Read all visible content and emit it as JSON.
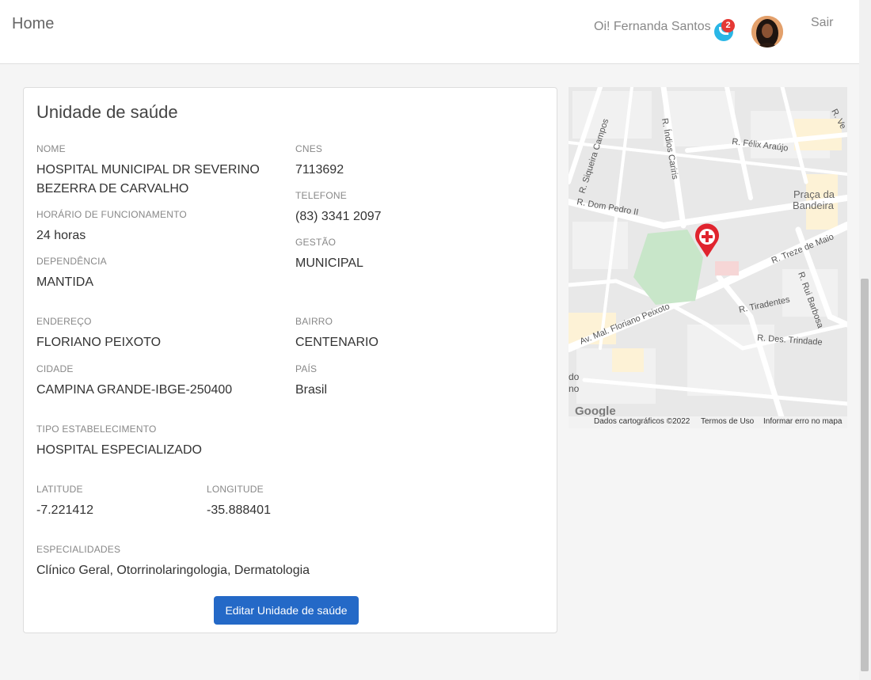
{
  "header": {
    "home": "Home",
    "greeting": "Oi! Fernanda Santos",
    "notification_count": "2",
    "logout": "Sair"
  },
  "card": {
    "title": "Unidade de saúde",
    "fields": {
      "nome": {
        "label": "NOME",
        "value": "HOSPITAL MUNICIPAL DR SEVERINO BEZERRA DE CARVALHO"
      },
      "cnes": {
        "label": "CNES",
        "value": "7113692"
      },
      "telefone": {
        "label": "TELEFONE",
        "value": "(83) 3341 2097"
      },
      "horario": {
        "label": "HORÁRIO DE FUNCIONAMENTO",
        "value": "24 horas"
      },
      "gestao": {
        "label": "GESTÃO",
        "value": "MUNICIPAL"
      },
      "dependencia": {
        "label": "DEPENDÊNCIA",
        "value": "MANTIDA"
      },
      "endereco": {
        "label": "ENDEREÇO",
        "value": "FLORIANO PEIXOTO"
      },
      "bairro": {
        "label": "BAIRRO",
        "value": "CENTENARIO"
      },
      "cidade": {
        "label": "CIDADE",
        "value": "CAMPINA GRANDE-IBGE-250400"
      },
      "pais": {
        "label": "PAÍS",
        "value": "Brasil"
      },
      "tipo": {
        "label": "TIPO ESTABELECIMENTO",
        "value": "HOSPITAL ESPECIALIZADO"
      },
      "latitude": {
        "label": "LATITUDE",
        "value": "-7.221412"
      },
      "longitude": {
        "label": "LONGITUDE",
        "value": "-35.888401"
      },
      "especialidades": {
        "label": "ESPECIALIDADES",
        "value": "Clínico Geral, Otorrinolaringologia, Dermatologia"
      }
    },
    "edit_button": "Editar Unidade de saúde"
  },
  "map": {
    "streets": {
      "siqueira": "R. Siqueira Campos",
      "indios": "R. Índios Cariris",
      "felix": "R. Félix Araújo",
      "praca_1": "Praça da",
      "praca_2": "Bandeira",
      "dom_pedro": "R. Dom Pedro II",
      "treze": "R. Treze de Maio",
      "rui": "R. Rui Barbosa",
      "tiradentes": "R. Tiradentes",
      "floriano": "Av. Mal. Floriano Peixoto",
      "trindade": "R. Des. Trindade",
      "frag_top": "R. Ve",
      "frag_left1": "do",
      "frag_left2": "no"
    },
    "google": "Google",
    "footer": {
      "data": "Dados cartográficos ©2022",
      "terms": "Termos de Uso",
      "report": "Informar erro no mapa"
    },
    "marker_icon": "hospital-pin-icon"
  },
  "colors": {
    "primary_button": "#2469c7",
    "marker": "#e0242e",
    "park": "#c8e6c9",
    "notification_badge": "#e53935",
    "chat_icon": "#29b6e6"
  }
}
